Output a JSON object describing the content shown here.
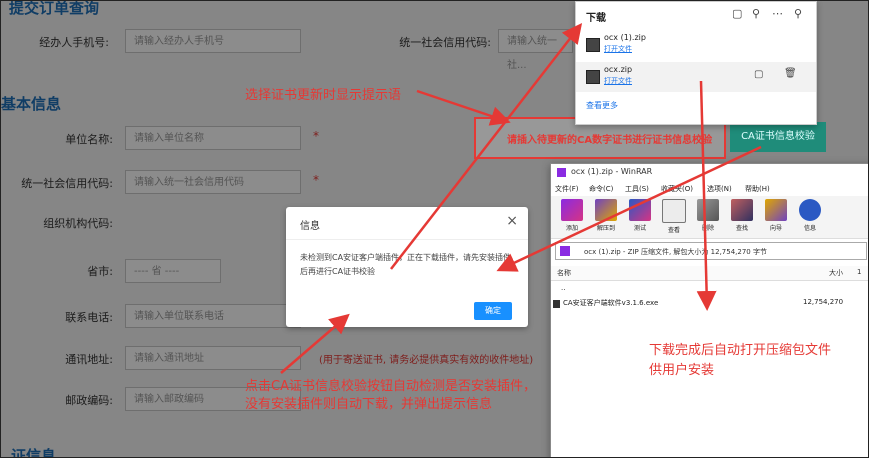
{
  "page": {
    "top_section_title": "提交订单查询",
    "base_section_title": "基本信息",
    "bottom_section_title": "证信息",
    "fields": [
      {
        "label": "经办人手机号:",
        "placeholder": "请输入经办人手机号"
      },
      {
        "label": "统一社会信用代码:",
        "placeholder": "请输入统一社..."
      },
      {
        "label": "单位名称:",
        "placeholder": "请输入单位名称"
      },
      {
        "label": "统一社会信用代码:",
        "placeholder": "请输入统一社会信用代码"
      },
      {
        "label": "组织机构代码:",
        "placeholder": ""
      },
      {
        "label": "省市:",
        "placeholder": "---- 省 ----"
      },
      {
        "label": "联系电话:",
        "placeholder": "请输入单位联系电话"
      },
      {
        "label": "通讯地址:",
        "placeholder": "请输入通讯地址"
      },
      {
        "label": "邮政编码:",
        "placeholder": "请输入邮政编码"
      }
    ],
    "address_note": "(用于寄送证书, 请务必提供真实有效的收件地址)",
    "ca_button": "CA证书信息校验",
    "hint_banner": "请插入待更新的CA数字证书进行证书信息校验"
  },
  "dialog": {
    "title": "信息",
    "close": "×",
    "message": "未检测到CA安证客户端插件，正在下载插件，请先安装插件后再进行CA证书校验",
    "ok": "确定"
  },
  "downloads": {
    "title": "下载",
    "items": [
      {
        "name": "ocx (1).zip",
        "action": "打开文件"
      },
      {
        "name": "ocx.zip",
        "action": "打开文件"
      }
    ],
    "more": "查看更多"
  },
  "winrar": {
    "title": "ocx (1).zip - WinRAR",
    "menu": [
      "文件(F)",
      "命令(C)",
      "工具(S)",
      "收藏夹(O)",
      "选项(N)",
      "帮助(H)"
    ],
    "toolbar": [
      "添加",
      "解压到",
      "测试",
      "查看",
      "删除",
      "查找",
      "向导",
      "信息"
    ],
    "path": "ocx (1).zip - ZIP 压缩文件, 解包大小为 12,754,270 字节",
    "columns": [
      "名称",
      "大小"
    ],
    "rows": [
      {
        "name": "..",
        "size": ""
      },
      {
        "name": "CA安证客户端软件v3.1.6.exe",
        "size": "12,754,270"
      }
    ],
    "extra_col": "1"
  },
  "annotations": {
    "a1": "选择证书更新时显示提示语",
    "a2": "点击CA证书信息校验按钮自动检测是否安装插件，",
    "a2b": "没有安装插件则自动下载，并弹出提示信息",
    "a3": "下载完成后自动打开压缩包文件",
    "a3b": "供用户安装"
  },
  "colors": {
    "accent": "#1f8c7a",
    "annotation": "#e53935",
    "link": "#1a73e8",
    "primary": "#1890ff"
  }
}
